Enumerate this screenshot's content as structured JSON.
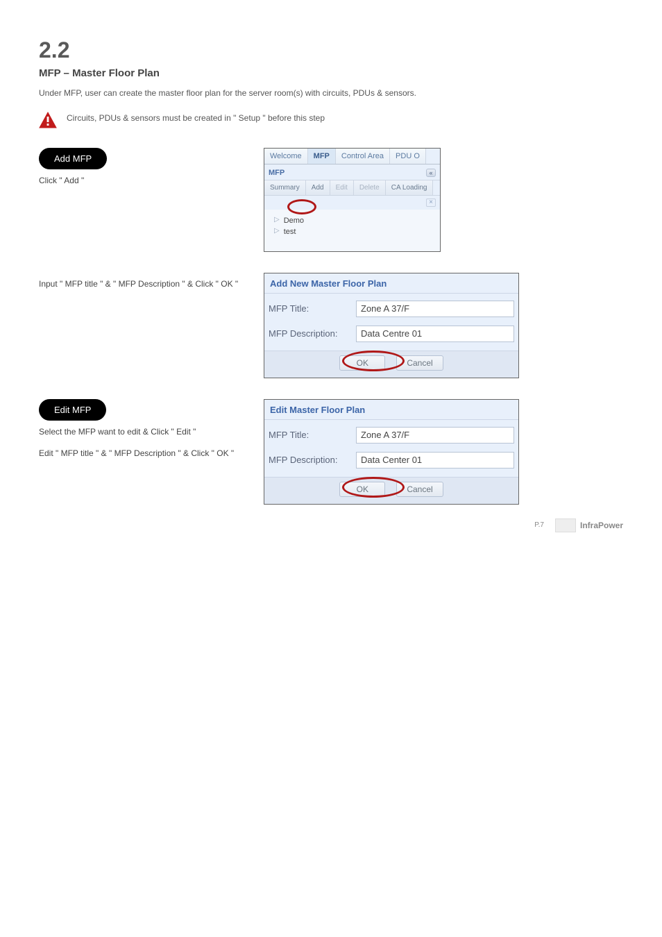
{
  "header": {
    "section_num": "2.2",
    "title": "MFP – Master Floor Plan",
    "intro": "Under MFP, user can create the master floor plan for the server room(s) with circuits, PDUs & sensors.",
    "warning": "Circuits, PDUs & sensors must be created in   \" Setup \"   before this step"
  },
  "add": {
    "pill": "Add MFP",
    "instr": "Click   \" Add \"",
    "step2": "Input   \" MFP title \"   &   \" MFP Description \"   &   Click   \" OK \""
  },
  "edit": {
    "pill": "Edit MFP",
    "instr": "Select the MFP want to edit & Click   \" Edit   \"",
    "step2": "Edit   \" MFP title \"   &   \" MFP Description \"   &   Click   \" OK \""
  },
  "panel1": {
    "tabs": {
      "welcome": "Welcome",
      "mfp": "MFP",
      "control_area": "Control Area",
      "pdu": "PDU O"
    },
    "subhead": "MFP",
    "subtabs": {
      "summary": "Summary",
      "add": "Add",
      "edit": "Edit",
      "delete": "Delete",
      "caloading": "CA Loading"
    },
    "tree": {
      "item1": "Demo",
      "item2": "test"
    }
  },
  "dialog_add": {
    "title": "Add New Master Floor Plan",
    "labels": {
      "title": "MFP  Title:",
      "desc": "MFP  Description:"
    },
    "values": {
      "title": "Zone A 37/F",
      "desc": "Data Centre 01"
    },
    "buttons": {
      "ok": "OK",
      "cancel": "Cancel"
    }
  },
  "dialog_edit": {
    "title": "Edit Master Floor Plan",
    "labels": {
      "title": "MFP Title:",
      "desc": "MFP  Description:"
    },
    "values": {
      "title": "Zone A 37/F",
      "desc": "Data Center 01"
    },
    "buttons": {
      "ok": "OK",
      "cancel": "Cancel"
    }
  },
  "footer": {
    "pagenum": "P.7",
    "logo": "InfraPower"
  }
}
